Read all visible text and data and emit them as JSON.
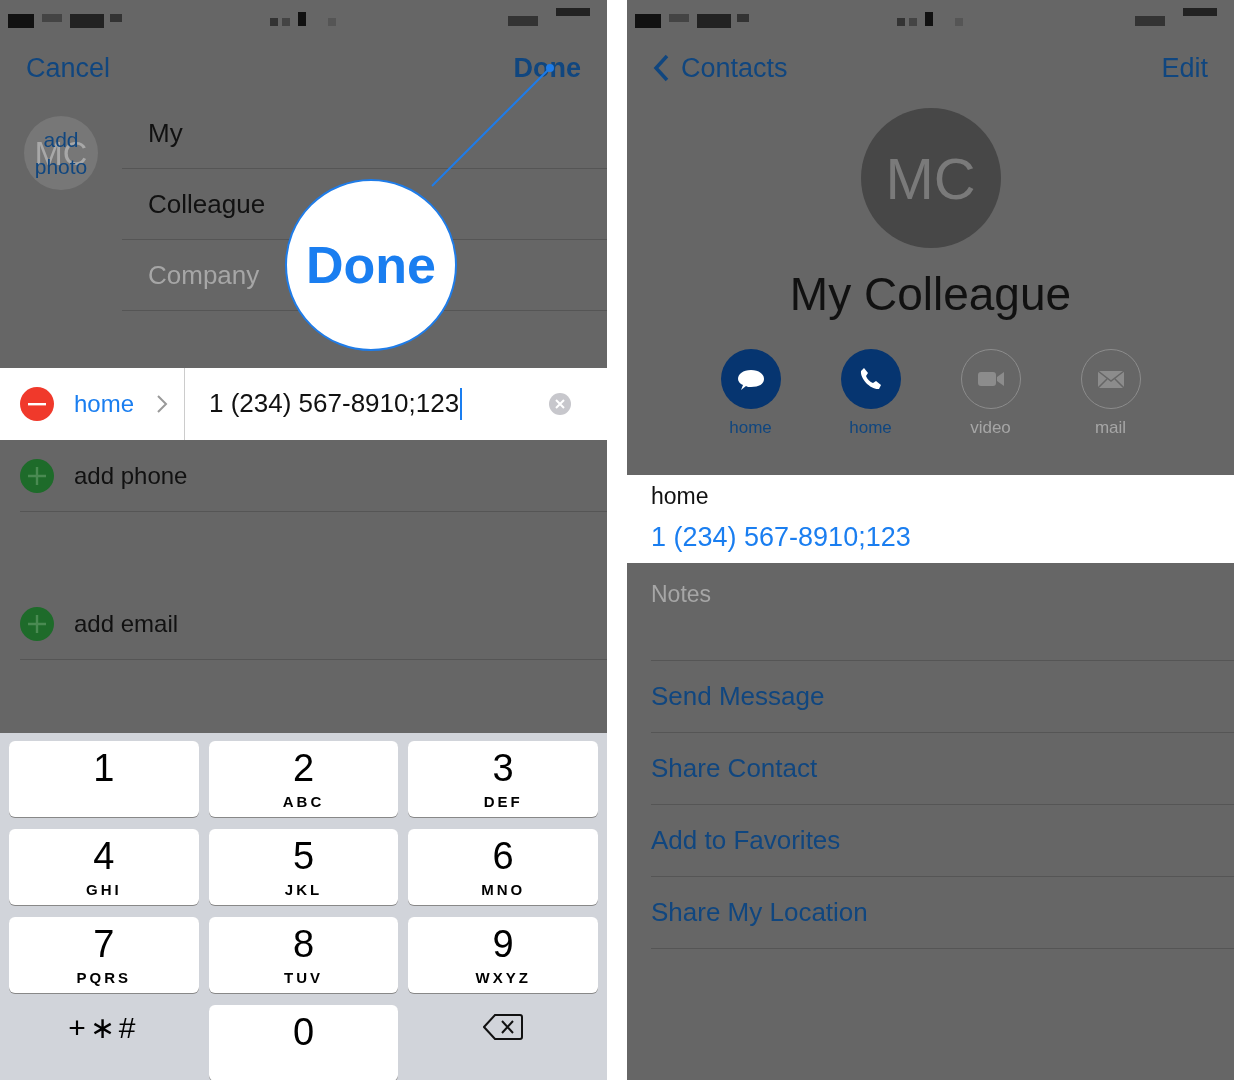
{
  "left_screen": {
    "nav": {
      "cancel": "Cancel",
      "done": "Done"
    },
    "photo": {
      "initials": "MC",
      "label": "add photo"
    },
    "fields": [
      {
        "value": "My"
      },
      {
        "value": "Colleague"
      },
      {
        "placeholder": "Company"
      }
    ],
    "callout": {
      "text": "Done"
    },
    "phone_row": {
      "label": "home",
      "value": "1 (234) 567-8910;123"
    },
    "add_rows": [
      {
        "label": "add phone"
      },
      {
        "label": "add email"
      }
    ],
    "keypad": [
      {
        "kind": "digit",
        "digit": "1"
      },
      {
        "kind": "digit",
        "digit": "2",
        "letters": "ABC"
      },
      {
        "kind": "digit",
        "digit": "3",
        "letters": "DEF"
      },
      {
        "kind": "digit",
        "digit": "4",
        "letters": "GHI"
      },
      {
        "kind": "digit",
        "digit": "5",
        "letters": "JKL"
      },
      {
        "kind": "digit",
        "digit": "6",
        "letters": "MNO"
      },
      {
        "kind": "digit",
        "digit": "7",
        "letters": "PQRS"
      },
      {
        "kind": "digit",
        "digit": "8",
        "letters": "TUV"
      },
      {
        "kind": "digit",
        "digit": "9",
        "letters": "WXYZ"
      },
      {
        "kind": "symbols",
        "text": "+∗#"
      },
      {
        "kind": "digit",
        "digit": "0"
      },
      {
        "kind": "delete"
      }
    ]
  },
  "right_screen": {
    "nav": {
      "back": "Contacts",
      "edit": "Edit"
    },
    "avatar": {
      "initials": "MC"
    },
    "name": "My Colleague",
    "actions": [
      {
        "kind": "message",
        "label": "home",
        "enabled": true
      },
      {
        "kind": "phone",
        "label": "home",
        "enabled": true
      },
      {
        "kind": "video",
        "label": "video",
        "enabled": false
      },
      {
        "kind": "mail",
        "label": "mail",
        "enabled": false
      }
    ],
    "phone_card": {
      "label": "home",
      "value": "1 (234) 567-8910;123"
    },
    "notes": {
      "placeholder": "Notes"
    },
    "links": [
      "Send Message",
      "Share Contact",
      "Add to Favorites",
      "Share My Location"
    ]
  }
}
